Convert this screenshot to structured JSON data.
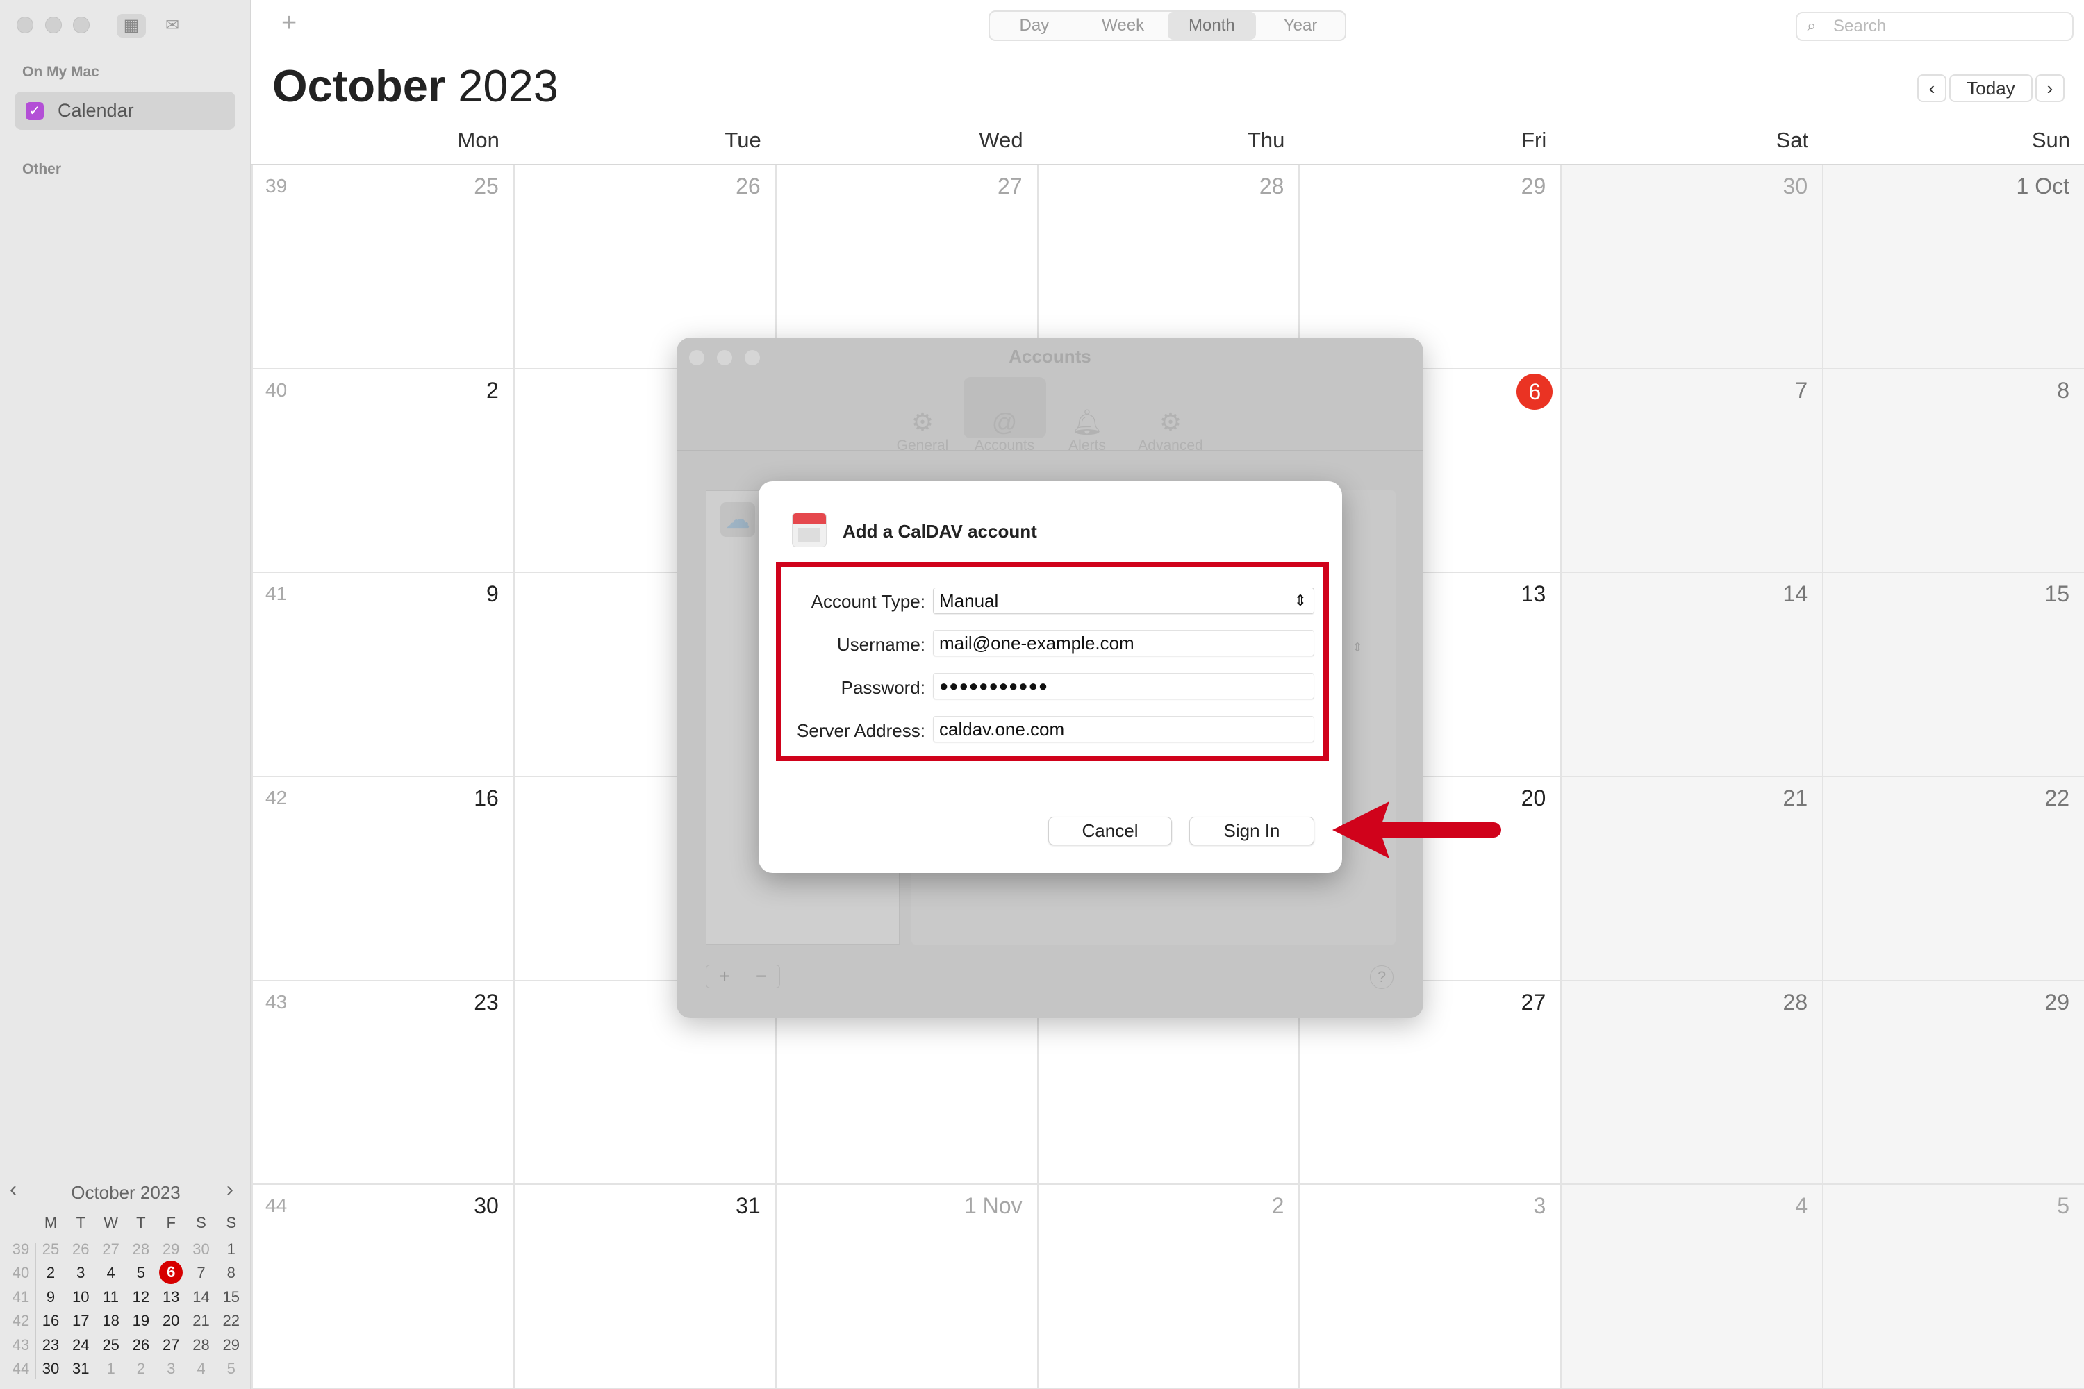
{
  "sidebar": {
    "on_my_mac": "On My Mac",
    "calendar_item": "Calendar",
    "other": "Other",
    "mini_calendar": {
      "title": "October 2023",
      "weekdays": [
        "M",
        "T",
        "W",
        "T",
        "F",
        "S",
        "S"
      ],
      "weeks": [
        {
          "wk": "39",
          "days": [
            "25",
            "26",
            "27",
            "28",
            "29",
            "30",
            "1"
          ],
          "dim": [
            1,
            1,
            1,
            1,
            1,
            1,
            0
          ]
        },
        {
          "wk": "40",
          "days": [
            "2",
            "3",
            "4",
            "5",
            "6",
            "7",
            "8"
          ],
          "dim": [
            0,
            0,
            0,
            0,
            0,
            0,
            0
          ]
        },
        {
          "wk": "41",
          "days": [
            "9",
            "10",
            "11",
            "12",
            "13",
            "14",
            "15"
          ],
          "dim": [
            0,
            0,
            0,
            0,
            0,
            0,
            0
          ]
        },
        {
          "wk": "42",
          "days": [
            "16",
            "17",
            "18",
            "19",
            "20",
            "21",
            "22"
          ],
          "dim": [
            0,
            0,
            0,
            0,
            0,
            0,
            0
          ]
        },
        {
          "wk": "43",
          "days": [
            "23",
            "24",
            "25",
            "26",
            "27",
            "28",
            "29"
          ],
          "dim": [
            0,
            0,
            0,
            0,
            0,
            0,
            0
          ]
        },
        {
          "wk": "44",
          "days": [
            "30",
            "31",
            "1",
            "2",
            "3",
            "4",
            "5"
          ],
          "dim": [
            0,
            0,
            1,
            1,
            1,
            1,
            1
          ]
        }
      ],
      "today": "6"
    }
  },
  "toolbar": {
    "views": [
      "Day",
      "Week",
      "Month",
      "Year"
    ],
    "selected_view": "Month",
    "search_placeholder": "Search",
    "today": "Today"
  },
  "header": {
    "month": "October",
    "year": "2023"
  },
  "calendar": {
    "weekdays": [
      "Mon",
      "Tue",
      "Wed",
      "Thu",
      "Fri",
      "Sat",
      "Sun"
    ],
    "weeks": [
      {
        "wk": "39",
        "days": [
          "25",
          "26",
          "27",
          "28",
          "29",
          "30",
          "1 Oct"
        ],
        "dim": [
          1,
          1,
          1,
          1,
          1,
          1,
          0
        ]
      },
      {
        "wk": "40",
        "days": [
          "2",
          "3",
          "4",
          "5",
          "6",
          "7",
          "8"
        ],
        "dim": [
          0,
          0,
          0,
          0,
          0,
          0,
          0
        ]
      },
      {
        "wk": "41",
        "days": [
          "9",
          "10",
          "11",
          "12",
          "13",
          "14",
          "15"
        ],
        "dim": [
          0,
          0,
          0,
          0,
          0,
          0,
          0
        ]
      },
      {
        "wk": "42",
        "days": [
          "16",
          "17",
          "18",
          "19",
          "20",
          "21",
          "22"
        ],
        "dim": [
          0,
          0,
          0,
          0,
          0,
          0,
          0
        ]
      },
      {
        "wk": "43",
        "days": [
          "23",
          "24",
          "25",
          "26",
          "27",
          "28",
          "29"
        ],
        "dim": [
          0,
          0,
          0,
          0,
          0,
          0,
          0
        ]
      },
      {
        "wk": "44",
        "days": [
          "30",
          "31",
          "1 Nov",
          "2",
          "3",
          "4",
          "5"
        ],
        "dim": [
          0,
          0,
          1,
          1,
          1,
          1,
          1
        ]
      }
    ],
    "today": "6",
    "today_color": "#ea3323"
  },
  "accounts_window": {
    "title": "Accounts",
    "tabs": [
      {
        "label": "General",
        "icon": "gear-icon"
      },
      {
        "label": "Accounts",
        "icon": "at-icon"
      },
      {
        "label": "Alerts",
        "icon": "bell-icon"
      },
      {
        "label": "Advanced",
        "icon": "gears-icon"
      }
    ],
    "selected_tab": "Accounts",
    "help": "?"
  },
  "dialog": {
    "title": "Add a CalDAV account",
    "account_type_label": "Account Type:",
    "account_type_value": "Manual",
    "username_label": "Username:",
    "username_value": "mail@one-example.com",
    "password_label": "Password:",
    "password_value": "●●●●●●●●●●●",
    "server_label": "Server Address:",
    "server_value": "caldav.one.com",
    "cancel": "Cancel",
    "sign_in": "Sign In",
    "highlight_color": "#d0021b"
  }
}
